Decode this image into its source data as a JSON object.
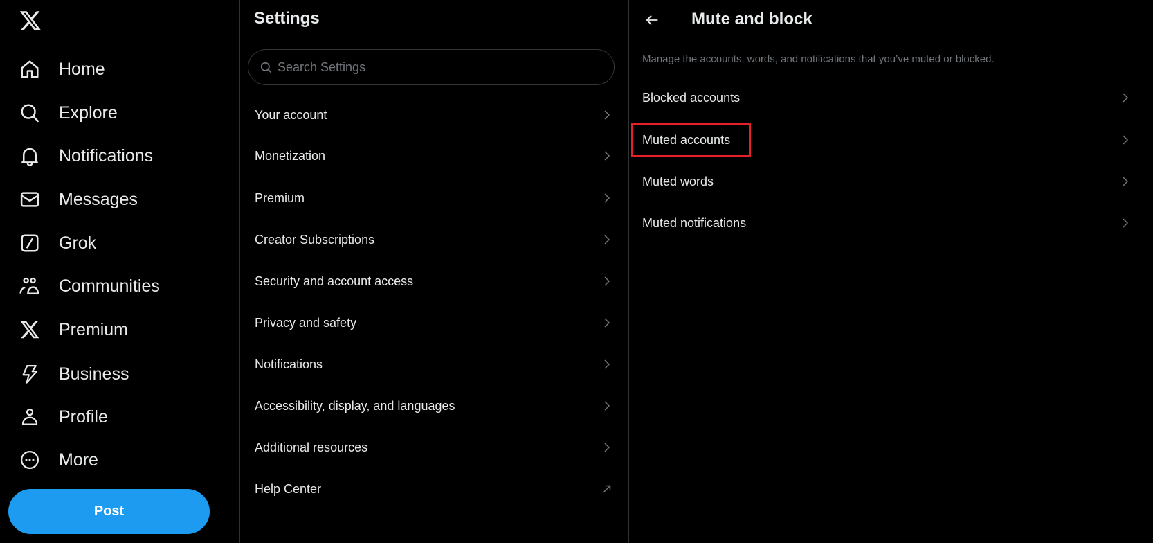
{
  "nav": {
    "logo": "x-logo",
    "items": [
      {
        "label": "Home",
        "icon": "home-icon"
      },
      {
        "label": "Explore",
        "icon": "search-icon"
      },
      {
        "label": "Notifications",
        "icon": "bell-icon"
      },
      {
        "label": "Messages",
        "icon": "envelope-icon"
      },
      {
        "label": "Grok",
        "icon": "grok-icon"
      },
      {
        "label": "Communities",
        "icon": "people-icon"
      },
      {
        "label": "Premium",
        "icon": "x-logo-icon"
      },
      {
        "label": "Business",
        "icon": "lightning-icon"
      },
      {
        "label": "Profile",
        "icon": "person-icon"
      },
      {
        "label": "More",
        "icon": "more-circle-icon"
      }
    ],
    "post_label": "Post",
    "accent": "#1D9BF0"
  },
  "settings": {
    "title": "Settings",
    "search_placeholder": "Search Settings",
    "items": [
      {
        "label": "Your account",
        "icon": "chevron-right-icon"
      },
      {
        "label": "Monetization",
        "icon": "chevron-right-icon"
      },
      {
        "label": "Premium",
        "icon": "chevron-right-icon"
      },
      {
        "label": "Creator Subscriptions",
        "icon": "chevron-right-icon"
      },
      {
        "label": "Security and account access",
        "icon": "chevron-right-icon"
      },
      {
        "label": "Privacy and safety",
        "icon": "chevron-right-icon"
      },
      {
        "label": "Notifications",
        "icon": "chevron-right-icon"
      },
      {
        "label": "Accessibility, display, and languages",
        "icon": "chevron-right-icon"
      },
      {
        "label": "Additional resources",
        "icon": "chevron-right-icon"
      },
      {
        "label": "Help Center",
        "icon": "external-arrow-icon"
      }
    ]
  },
  "detail": {
    "title": "Mute and block",
    "subtitle": "Manage the accounts, words, and notifications that you’ve muted or blocked.",
    "items": [
      {
        "label": "Blocked accounts"
      },
      {
        "label": "Muted accounts",
        "highlighted": true
      },
      {
        "label": "Muted words"
      },
      {
        "label": "Muted notifications"
      }
    ],
    "highlight_color": "#E8202A"
  }
}
